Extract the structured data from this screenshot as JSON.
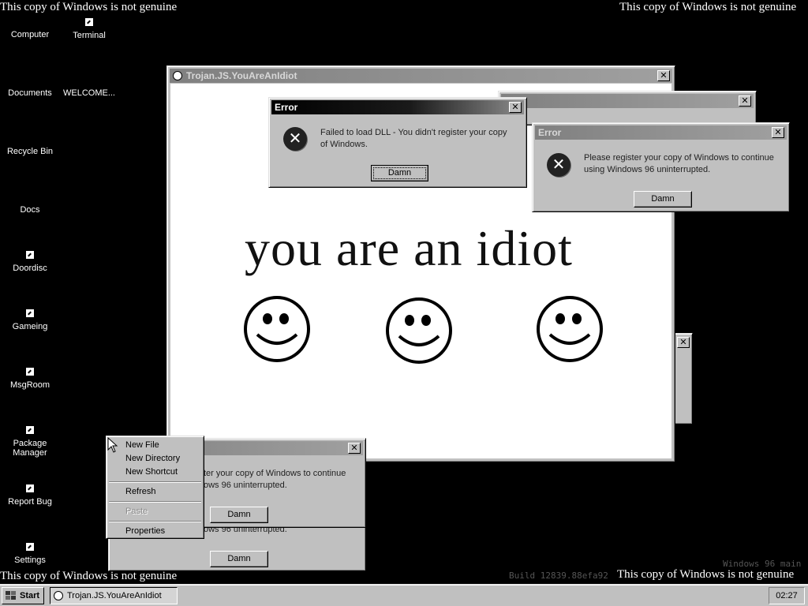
{
  "desktop": {
    "banners": [
      "This copy of Windows is not genuine",
      "This copy of Windows is not genuine",
      "This copy of Windows is not genuine",
      "This copy of Windows is not genuine"
    ],
    "icons": [
      {
        "label": "Computer",
        "icon": "computer-icon"
      },
      {
        "label": "Terminal",
        "icon": "shortcut-icon"
      },
      {
        "label": "Documents",
        "icon": "folder-icon"
      },
      {
        "label": "WELCOME...",
        "icon": "document-icon"
      },
      {
        "label": "Recycle Bin",
        "icon": "recycle-bin-icon"
      },
      {
        "label": "Docs",
        "icon": "folder-icon"
      },
      {
        "label": "Doordisc",
        "icon": "shortcut-icon"
      },
      {
        "label": "Gameing",
        "icon": "shortcut-icon"
      },
      {
        "label": "MsgRoom",
        "icon": "shortcut-icon"
      },
      {
        "label": "Package Manager",
        "icon": "shortcut-icon"
      },
      {
        "label": "Report Bug",
        "icon": "shortcut-icon"
      },
      {
        "label": "Settings",
        "icon": "shortcut-icon"
      }
    ],
    "watermark_line1": "Windows 96 main",
    "watermark_line2": "Build 12839.88efa92"
  },
  "trojan_window": {
    "title": "Trojan.JS.YouAreAnIdiot",
    "text": "you are an idiot"
  },
  "error_dialog_1": {
    "title": "Error",
    "message": "Failed to load DLL - You didn't register your copy of Windows.",
    "button": "Damn"
  },
  "error_dialog_2": {
    "title": "Error",
    "message": "Please register your copy of Windows to continue using Windows 96 uninterrupted.",
    "button": "Damn"
  },
  "lower_dialog": {
    "message_line1": "ter your copy of Windows to continue",
    "message_line2": "ows 96 uninterrupted.",
    "button": "Damn"
  },
  "bottom_dialog": {
    "message": "ows 96 uninterrupted.",
    "button": "Damn"
  },
  "context_menu": {
    "items": [
      "New File",
      "New Directory",
      "New Shortcut",
      "Refresh",
      "Paste",
      "Properties"
    ]
  },
  "taskbar": {
    "start_label": "Start",
    "task_label": "Trojan.JS.YouAreAnIdiot",
    "clock": "02:27"
  },
  "colors": {
    "desktop": "#000000",
    "window_face": "#c0c0c0",
    "titlebar_active": "#000000",
    "titlebar_inactive": "#808080"
  }
}
